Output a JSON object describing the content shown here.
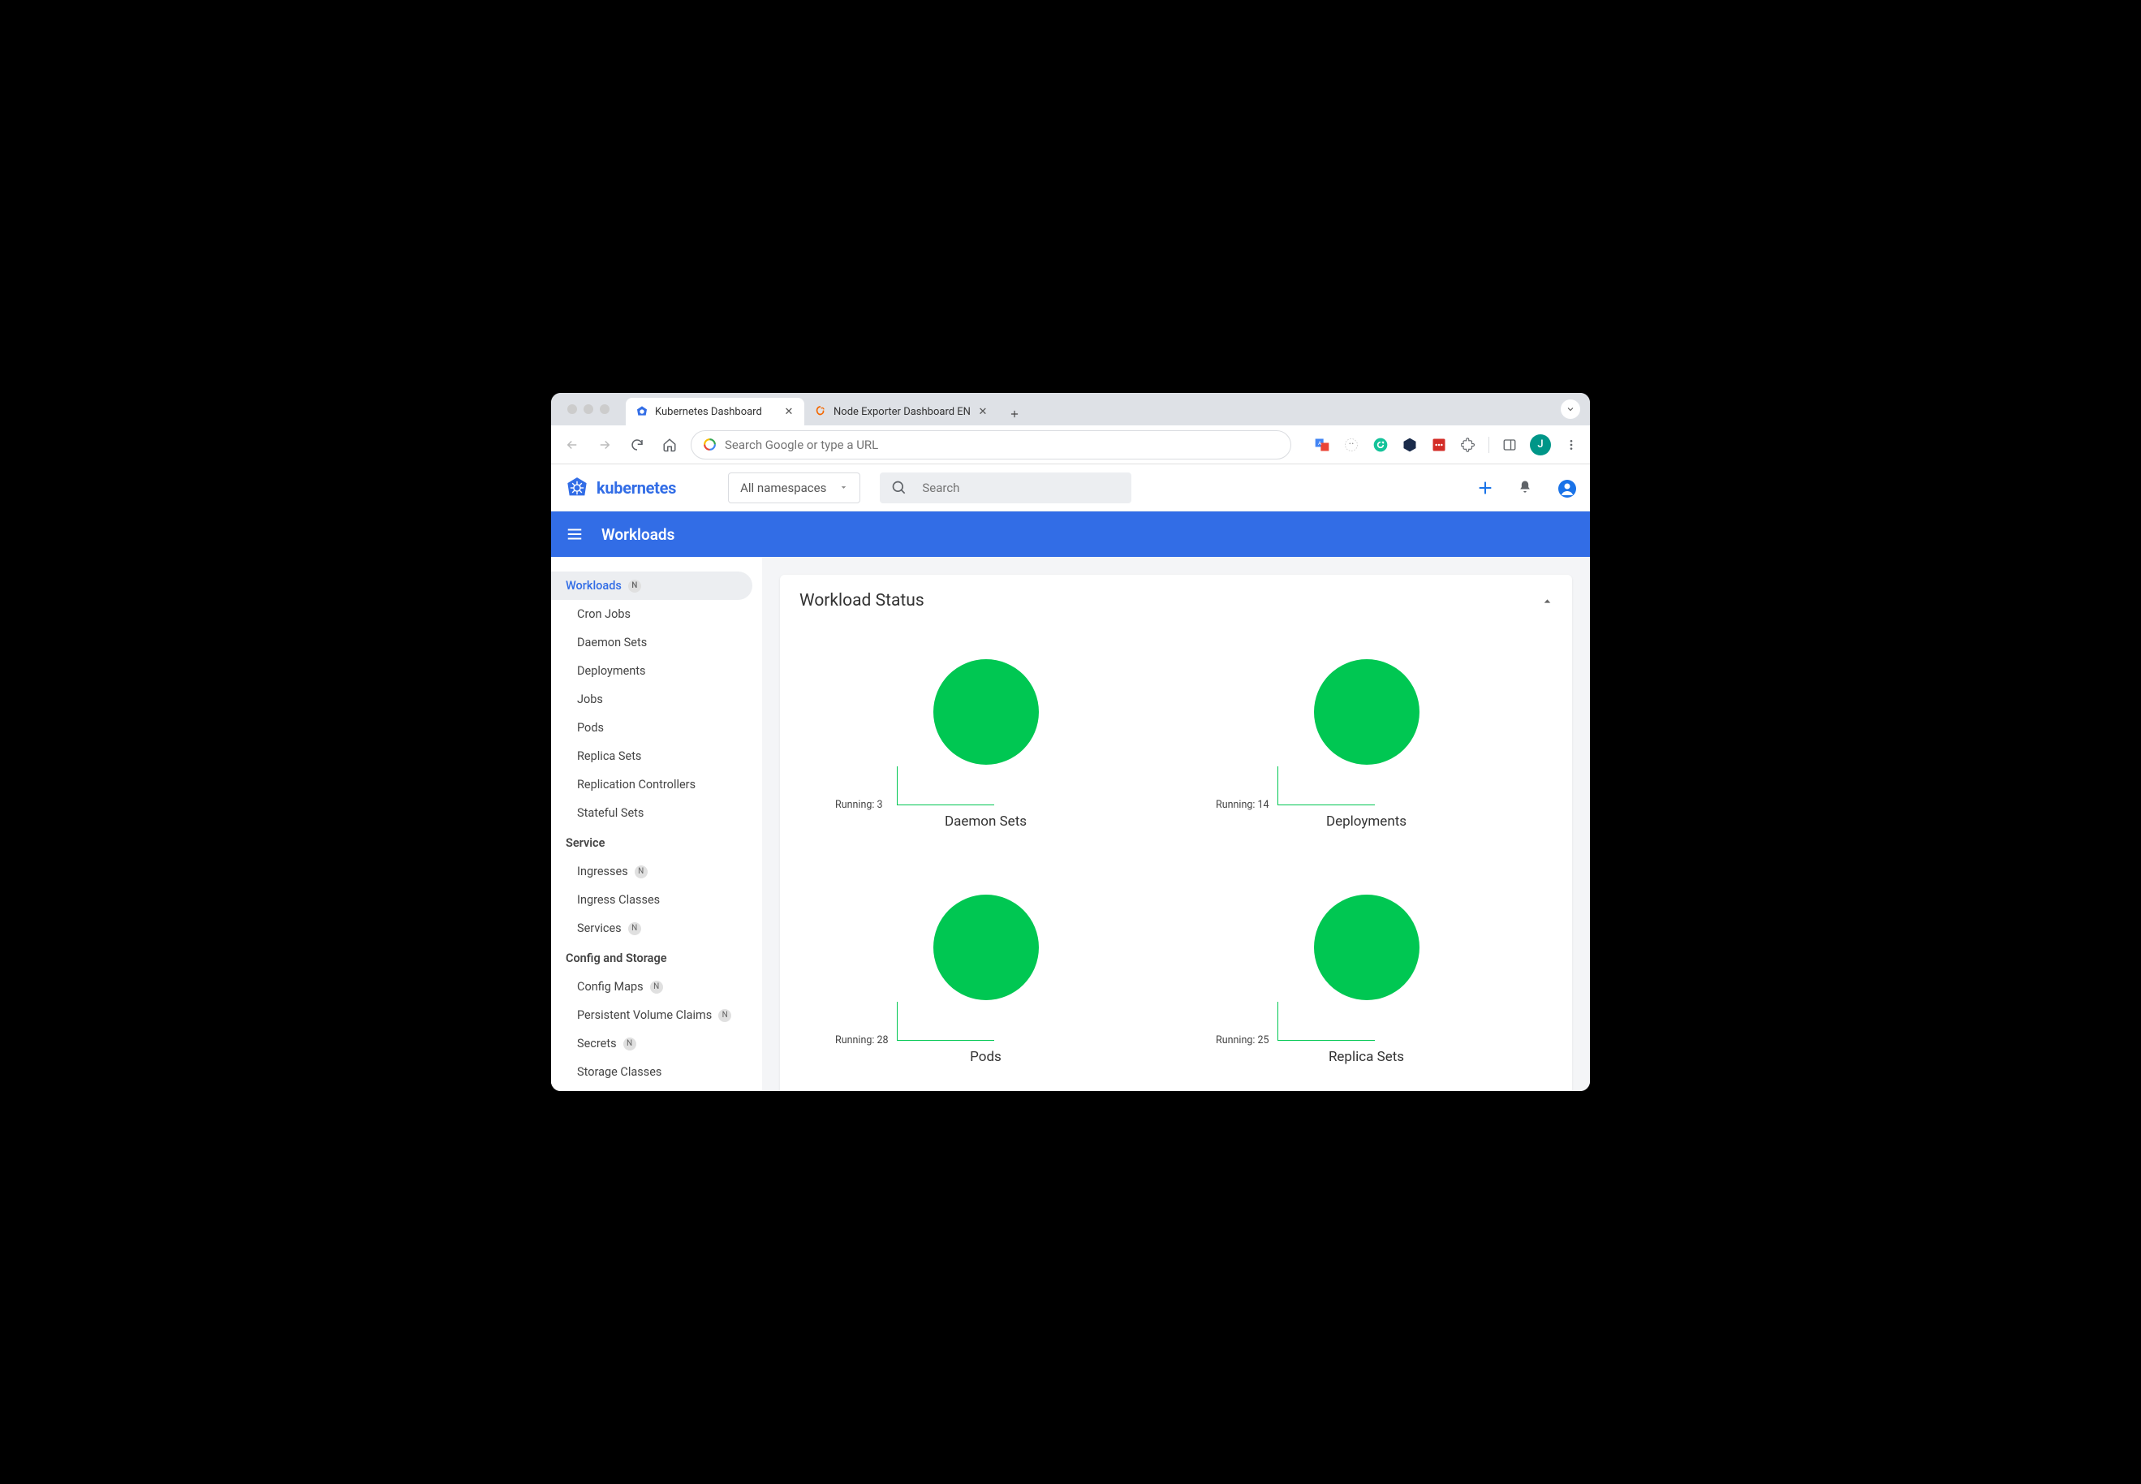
{
  "browser": {
    "tabs": [
      {
        "title": "Kubernetes Dashboard",
        "active": true
      },
      {
        "title": "Node Exporter Dashboard EN",
        "active": false
      }
    ],
    "omnibox_placeholder": "Search Google or type a URL",
    "avatar_letter": "J"
  },
  "header": {
    "logo_text": "kubernetes",
    "namespace_selector": "All namespaces",
    "search_placeholder": "Search"
  },
  "bluebar": {
    "title": "Workloads"
  },
  "sidebar": {
    "groups": [
      {
        "header": null,
        "items": [
          {
            "label": "Workloads",
            "badge": "N",
            "active": true,
            "sub": false
          },
          {
            "label": "Cron Jobs",
            "sub": true
          },
          {
            "label": "Daemon Sets",
            "sub": true
          },
          {
            "label": "Deployments",
            "sub": true
          },
          {
            "label": "Jobs",
            "sub": true
          },
          {
            "label": "Pods",
            "sub": true
          },
          {
            "label": "Replica Sets",
            "sub": true
          },
          {
            "label": "Replication Controllers",
            "sub": true
          },
          {
            "label": "Stateful Sets",
            "sub": true
          }
        ]
      },
      {
        "header": "Service",
        "items": [
          {
            "label": "Ingresses",
            "badge": "N",
            "sub": true
          },
          {
            "label": "Ingress Classes",
            "sub": true
          },
          {
            "label": "Services",
            "badge": "N",
            "sub": true
          }
        ]
      },
      {
        "header": "Config and Storage",
        "items": [
          {
            "label": "Config Maps",
            "badge": "N",
            "sub": true
          },
          {
            "label": "Persistent Volume Claims",
            "badge": "N",
            "sub": true
          },
          {
            "label": "Secrets",
            "badge": "N",
            "sub": true
          },
          {
            "label": "Storage Classes",
            "sub": true
          }
        ]
      }
    ]
  },
  "card": {
    "title": "Workload Status"
  },
  "chart_data": [
    {
      "type": "pie",
      "title": "Daemon Sets",
      "series": [
        {
          "name": "Running",
          "value": 3
        }
      ],
      "leader_label": "Running: 3",
      "color": "#00c752"
    },
    {
      "type": "pie",
      "title": "Deployments",
      "series": [
        {
          "name": "Running",
          "value": 14
        }
      ],
      "leader_label": "Running: 14",
      "color": "#00c752"
    },
    {
      "type": "pie",
      "title": "Pods",
      "series": [
        {
          "name": "Running",
          "value": 28
        }
      ],
      "leader_label": "Running: 28",
      "color": "#00c752"
    },
    {
      "type": "pie",
      "title": "Replica Sets",
      "series": [
        {
          "name": "Running",
          "value": 25
        }
      ],
      "leader_label": "Running: 25",
      "color": "#00c752"
    }
  ]
}
